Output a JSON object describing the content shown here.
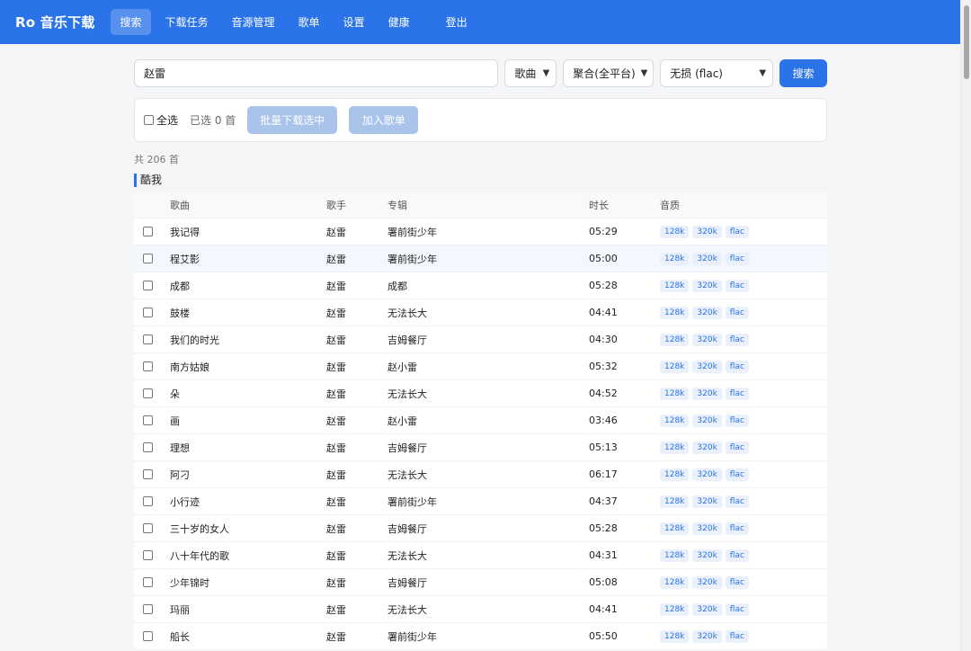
{
  "header": {
    "brand": "Ro 音乐下载",
    "nav": [
      {
        "label": "搜索",
        "active": true
      },
      {
        "label": "下载任务"
      },
      {
        "label": "音源管理"
      },
      {
        "label": "歌单"
      },
      {
        "label": "设置"
      },
      {
        "label": "健康"
      }
    ],
    "logout": "登出"
  },
  "search": {
    "query": "赵雷",
    "type": "歌曲",
    "platform": "聚合(全平台)",
    "quality": "无损 (flac)",
    "button": "搜索"
  },
  "toolbar": {
    "select_all": "全选",
    "selected_count": "已选 0 首",
    "batch_download": "批量下载选中",
    "add_playlist": "加入歌单"
  },
  "results": {
    "total": "共 206 首",
    "source": "酷我",
    "columns": [
      "歌曲",
      "歌手",
      "专辑",
      "时长",
      "音质"
    ],
    "rows": [
      {
        "title": "我记得",
        "artist": "赵雷",
        "album": "署前街少年",
        "duration": "05:29",
        "qualities": [
          "128k",
          "320k",
          "flac"
        ]
      },
      {
        "title": "程艾影",
        "artist": "赵雷",
        "album": "署前街少年",
        "duration": "05:00",
        "qualities": [
          "128k",
          "320k",
          "flac"
        ]
      },
      {
        "title": "成都",
        "artist": "赵雷",
        "album": "成都",
        "duration": "05:28",
        "qualities": [
          "128k",
          "320k",
          "flac"
        ]
      },
      {
        "title": "鼓楼",
        "artist": "赵雷",
        "album": "无法长大",
        "duration": "04:41",
        "qualities": [
          "128k",
          "320k",
          "flac"
        ]
      },
      {
        "title": "我们的时光",
        "artist": "赵雷",
        "album": "吉姆餐厅",
        "duration": "04:30",
        "qualities": [
          "128k",
          "320k",
          "flac"
        ]
      },
      {
        "title": "南方姑娘",
        "artist": "赵雷",
        "album": "赵小雷",
        "duration": "05:32",
        "qualities": [
          "128k",
          "320k",
          "flac"
        ]
      },
      {
        "title": "朵",
        "artist": "赵雷",
        "album": "无法长大",
        "duration": "04:52",
        "qualities": [
          "128k",
          "320k",
          "flac"
        ]
      },
      {
        "title": "画",
        "artist": "赵雷",
        "album": "赵小雷",
        "duration": "03:46",
        "qualities": [
          "128k",
          "320k",
          "flac"
        ]
      },
      {
        "title": "理想",
        "artist": "赵雷",
        "album": "吉姆餐厅",
        "duration": "05:13",
        "qualities": [
          "128k",
          "320k",
          "flac"
        ]
      },
      {
        "title": "阿刁",
        "artist": "赵雷",
        "album": "无法长大",
        "duration": "06:17",
        "qualities": [
          "128k",
          "320k",
          "flac"
        ]
      },
      {
        "title": "小行迹",
        "artist": "赵雷",
        "album": "署前街少年",
        "duration": "04:37",
        "qualities": [
          "128k",
          "320k",
          "flac"
        ]
      },
      {
        "title": "三十岁的女人",
        "artist": "赵雷",
        "album": "吉姆餐厅",
        "duration": "05:28",
        "qualities": [
          "128k",
          "320k",
          "flac"
        ]
      },
      {
        "title": "八十年代的歌",
        "artist": "赵雷",
        "album": "无法长大",
        "duration": "04:31",
        "qualities": [
          "128k",
          "320k",
          "flac"
        ]
      },
      {
        "title": "少年锦时",
        "artist": "赵雷",
        "album": "吉姆餐厅",
        "duration": "05:08",
        "qualities": [
          "128k",
          "320k",
          "flac"
        ]
      },
      {
        "title": "玛丽",
        "artist": "赵雷",
        "album": "无法长大",
        "duration": "04:41",
        "qualities": [
          "128k",
          "320k",
          "flac"
        ]
      },
      {
        "title": "船长",
        "artist": "赵雷",
        "album": "署前街少年",
        "duration": "05:50",
        "qualities": [
          "128k",
          "320k",
          "flac"
        ]
      }
    ]
  },
  "colors": {
    "accent": "#2a73e8",
    "disabled_button": "#a9c3ea",
    "tag_bg": "#e9f0fc"
  }
}
